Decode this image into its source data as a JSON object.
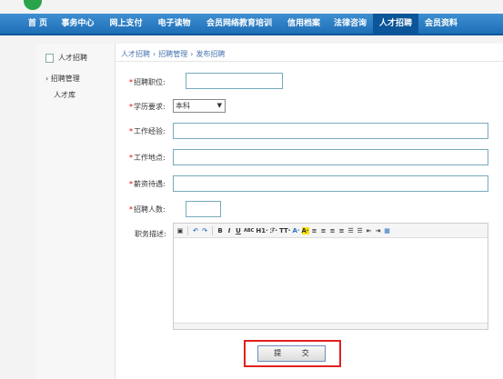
{
  "nav": {
    "items": [
      {
        "label": "首 页"
      },
      {
        "label": "事务中心"
      },
      {
        "label": "网上支付"
      },
      {
        "label": "电子读物"
      },
      {
        "label": "会员网络教育培训"
      },
      {
        "label": "信用档案"
      },
      {
        "label": "法律咨询"
      },
      {
        "label": "人才招聘"
      },
      {
        "label": "会员资料"
      }
    ],
    "active": "人才招聘"
  },
  "sidebar": {
    "title": "人才招聘",
    "items": [
      {
        "label": "› 招聘管理"
      },
      {
        "label": "人才库"
      }
    ]
  },
  "breadcrumb": {
    "items": [
      "人才招聘",
      "招聘管理",
      "发布招聘"
    ],
    "separator": "›"
  },
  "form": {
    "position_label": "招聘职位:",
    "education_label": "学历要求:",
    "education_value": "本科",
    "experience_label": "工作经验:",
    "location_label": "工作地点:",
    "salary_label": "薪资待遇:",
    "headcount_label": "招聘人数:",
    "description_label": "职务描述:",
    "required_mark": "*",
    "submit_label": "提 交"
  },
  "editor": {
    "toolbar": [
      "▣",
      "↶",
      "↷",
      "B",
      "I",
      "U",
      "ABC",
      "H1·",
      "ℱ·",
      "TT·",
      "A·",
      "A·",
      "≡",
      "≡",
      "≡",
      "≡",
      "☰",
      "☰",
      "⇤",
      "⇥",
      "▦"
    ]
  },
  "colors": {
    "nav_bg": "#2a7fc4",
    "nav_active": "#0b5598",
    "required": "#dd0000",
    "highlight_frame": "#e12020"
  }
}
